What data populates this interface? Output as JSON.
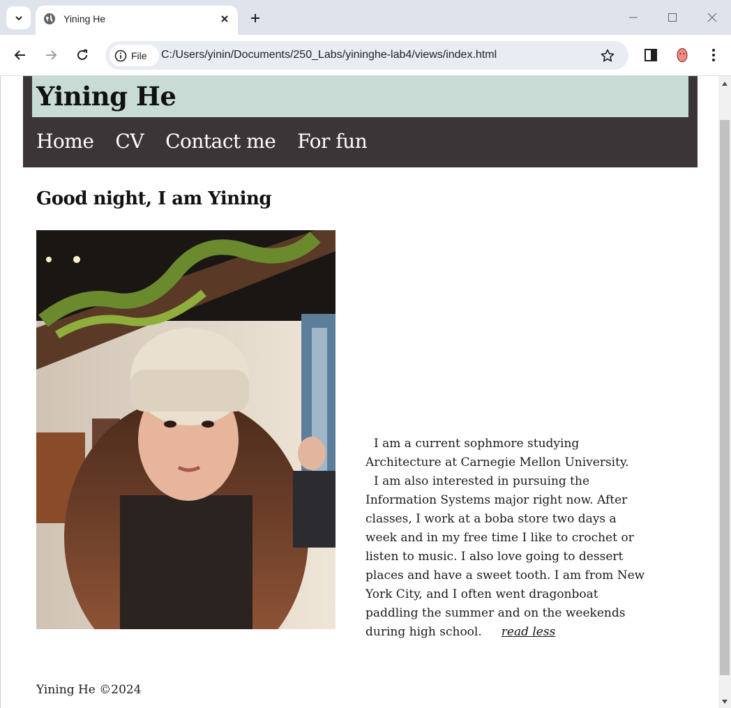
{
  "browser": {
    "tab_title": "Yining He",
    "chip_label": "File",
    "url": "C:/Users/yinin/Documents/250_Labs/yininghe-lab4/views/index.html"
  },
  "site": {
    "title": "Yining He",
    "nav": [
      "Home",
      "CV",
      "Contact me",
      "For fun"
    ],
    "greeting": "Good night, I am Yining",
    "bio_p1": "I am a current sophmore studying Architecture at Carnegie Mellon University.",
    "bio_p2": "I am also interested in pursuing the Information Systems major right now. After classes, I work at a boba store two days a week and in my free time I like to crochet or listen to music. I also love going to dessert places and have a sweet tooth. I am from New York City, and I often went dragonboat paddling the summer and on the weekends during high school.",
    "read_less": "read less",
    "footer": "Yining He ©2024"
  },
  "colors": {
    "header_bg": "#3b3537",
    "title_band": "#c8dbd5",
    "tabbar_bg": "#dfe3eb"
  }
}
